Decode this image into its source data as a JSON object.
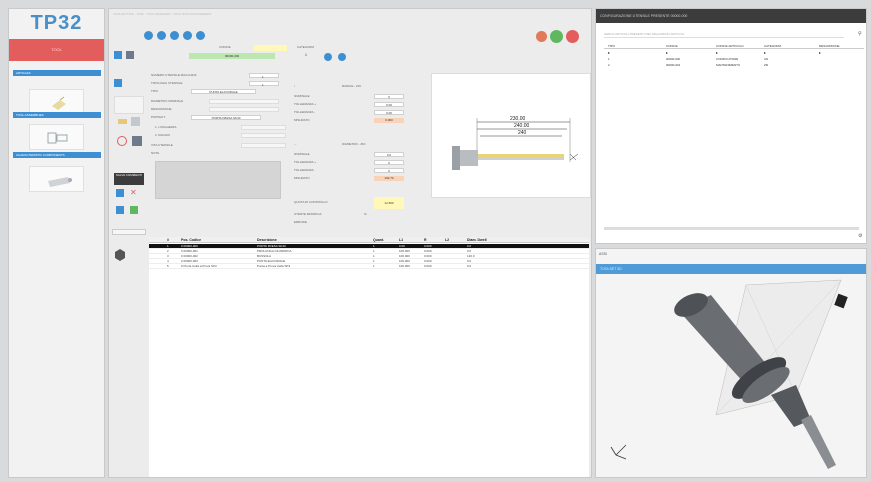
{
  "app": {
    "logo": "TP32",
    "window_title": "TOOLSETTING - TP32 - TOOL MANAGER - TOOL DATA MANAGEMENT"
  },
  "nav": {
    "red_item": "TOOL",
    "sections": [
      {
        "label": "ARTICLES"
      },
      {
        "label": "TOOL ASSEMBLIES"
      },
      {
        "label": "CHARACTERISTIC COMPONENTS"
      }
    ]
  },
  "form": {
    "code_label": "CODICE",
    "code_value": "00000-000",
    "category_label": "CATEGORIA",
    "category_value": "1",
    "rows": [
      {
        "label": "NUMERO UTENSILE MACCHINA",
        "value": "1"
      },
      {
        "label": "TIPOLOGIA UTENSILE",
        "value": "1"
      },
      {
        "label": "TIPO",
        "value": "PUNTA ELICOIDALE"
      },
      {
        "label": "DIAMETRO NOMINALE",
        "value": ""
      },
      {
        "label": "DESCRIZIONE",
        "value": ""
      },
      {
        "label": "PORTAUT.",
        "value": "PORTA FRESA SK40"
      },
      {
        "label": "1. LUNGHEZZA",
        "value": ""
      },
      {
        "label": "2. RAGGIO",
        "value": ""
      },
      {
        "label": "VITA UTENSILE",
        "value": ""
      },
      {
        "label": "NOTE",
        "value": ""
      }
    ],
    "save_label": "SALVA COMMENTI"
  },
  "params": {
    "lunghezza_label": "RADICE - ZIO",
    "lunghezza_rows": [
      {
        "label": "NOMINALE",
        "value": "0"
      },
      {
        "label": "TOLLERANZA +",
        "value": "0.00"
      },
      {
        "label": "TOLLERANZA -",
        "value": "0.00"
      },
      {
        "label": "MISURATO",
        "value": "0.000"
      }
    ],
    "diametro_label": "DIAMETRO - ZIO",
    "diametro_rows": [
      {
        "label": "NOMINALE",
        "value": "0.0"
      },
      {
        "label": "TOLLERANZA +",
        "value": "0"
      },
      {
        "label": "TOLLERANZA -",
        "value": "0"
      },
      {
        "label": "MISURATO",
        "value": "192.70"
      }
    ],
    "quota_label": "QUOTA DI CONTROLLO",
    "quota_value": "12.500",
    "quota_sub1": "UTENTE MODIFICA",
    "quota_sub2": "ERRORE"
  },
  "drawing": {
    "dims": [
      "230.00",
      "240.00",
      "240"
    ]
  },
  "table": {
    "headers": [
      "#",
      "Pos. Codice",
      "Descrizione",
      "Quant.",
      "L1",
      "R",
      "L2",
      "Diam. Dwell"
    ],
    "rows": [
      [
        "1",
        "0 00000-000",
        "PORTA FRESA SK40",
        "1",
        "0.00",
        "0.000",
        "",
        "0.0"
      ],
      [
        "2",
        "0 00000-001",
        "PROLUNGA CILINDRICA",
        "1",
        "100.000",
        "0.000",
        "",
        "0.0"
      ],
      [
        "3",
        "0 00000-002",
        "BUSSOLA",
        "1",
        "100.000",
        "0.000",
        "",
        "120.0"
      ],
      [
        "4",
        "0 00000-003",
        "PUNTA ELICOIDALE",
        "1",
        "100.000",
        "0.000",
        "",
        "0.0"
      ],
      [
        "5",
        "0 Punta Cella a Prova SK3",
        "Punta a Prova Cella SK3",
        "1",
        "100.000",
        "0.000",
        "",
        "0.0"
      ]
    ]
  },
  "right_top": {
    "title": "CONFIGURAZIONE UTENSILE PRESENTE 00000-000",
    "search_placeholder": "CERCA ARTICOLI PRESENTI NEL MAGAZZINO ARTICOLI",
    "headers": [
      "TIPO",
      "CODICE",
      "CODICE ARTICOLO",
      "CATEGORIA",
      "DESCRIZIONE"
    ],
    "rows": [
      [
        "1",
        "00000-000",
        "CODIFICATORE",
        "AN",
        ""
      ],
      [
        "2",
        "00000-001",
        "MANTENIMENTO",
        "ZM",
        ""
      ]
    ]
  },
  "right_bottom": {
    "tab": "ASSI",
    "title": "TOOLSET 3D"
  },
  "colors": {
    "accent_blue": "#3e8fd1",
    "red": "#e35d5d",
    "green": "#5fb85f",
    "dark": "#3c3c3c"
  }
}
